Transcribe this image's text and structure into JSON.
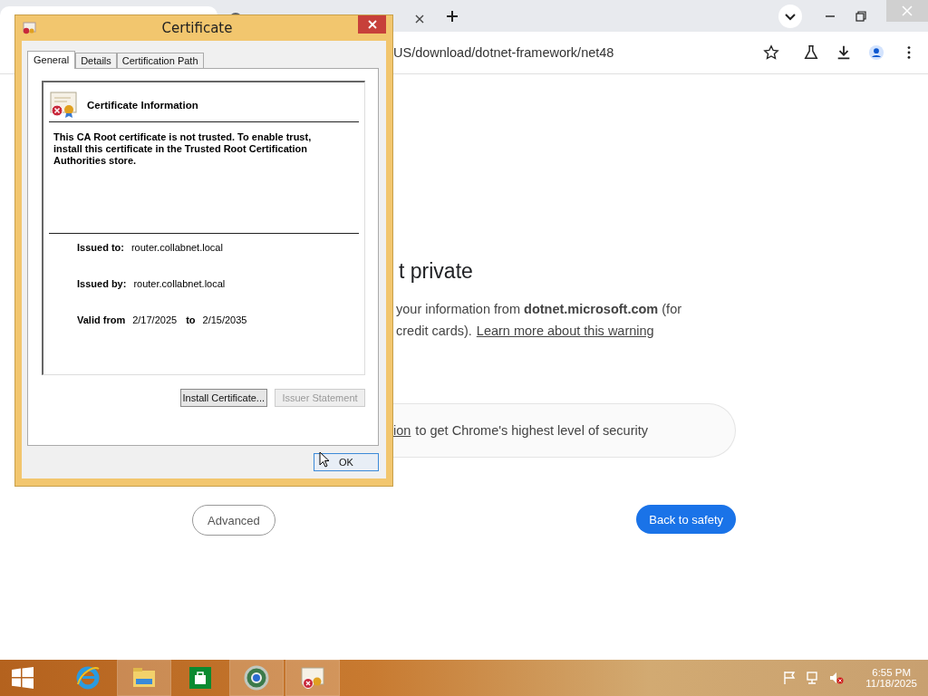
{
  "browser": {
    "tabs": [
      {
        "selected": true
      },
      {
        "selected": false
      }
    ],
    "address": "US/download/dotnet-framework/net48",
    "heading": "t private",
    "lines": [
      {
        "parts": [
          {
            "kind": "text",
            "text": "your information from **dotnet.microsoft.com** (for"
          }
        ]
      },
      {
        "parts": [
          {
            "kind": "text",
            "text": "credit cards)."
          },
          {
            "kind": "link",
            "text": "Learn more about this warning"
          }
        ]
      }
    ],
    "card": {
      "link": "ion",
      "text": "to get Chrome's highest level of security"
    },
    "advanced_button": "Advanced",
    "safety_button": "Back to safety"
  },
  "dialog": {
    "title": "Certificate",
    "tabs": [
      {
        "label": "General",
        "selected": true
      },
      {
        "label": "Details",
        "selected": false
      },
      {
        "label": "Certification Path",
        "selected": false
      }
    ],
    "info_title": "Certificate Information",
    "info_text": "This CA Root certificate is not trusted. To enable trust, install this certificate in the Trusted Root Certification Authorities store.",
    "fields": [
      {
        "label": "Issued to:",
        "value": "router.collabnet.local"
      },
      {
        "label": "Issued by:",
        "value": "router.collabnet.local"
      }
    ],
    "valid": {
      "label": "Valid from",
      "from": "2/17/2025",
      "to_label": "to",
      "to": "2/15/2035"
    },
    "buttons": [
      {
        "label": "Install Certificate...",
        "disabled": false
      },
      {
        "label": "Issuer Statement",
        "disabled": true
      }
    ],
    "ok_button": "OK"
  },
  "taskbar": {
    "apps": [
      {
        "kind": "ie",
        "selected": false
      },
      {
        "kind": "explorer",
        "selected": true
      },
      {
        "kind": "store",
        "selected": false
      },
      {
        "kind": "chrome",
        "selected": true
      },
      {
        "kind": "cert",
        "selected": true
      }
    ],
    "time": "6:55 PM",
    "date": "11/18/2025"
  }
}
